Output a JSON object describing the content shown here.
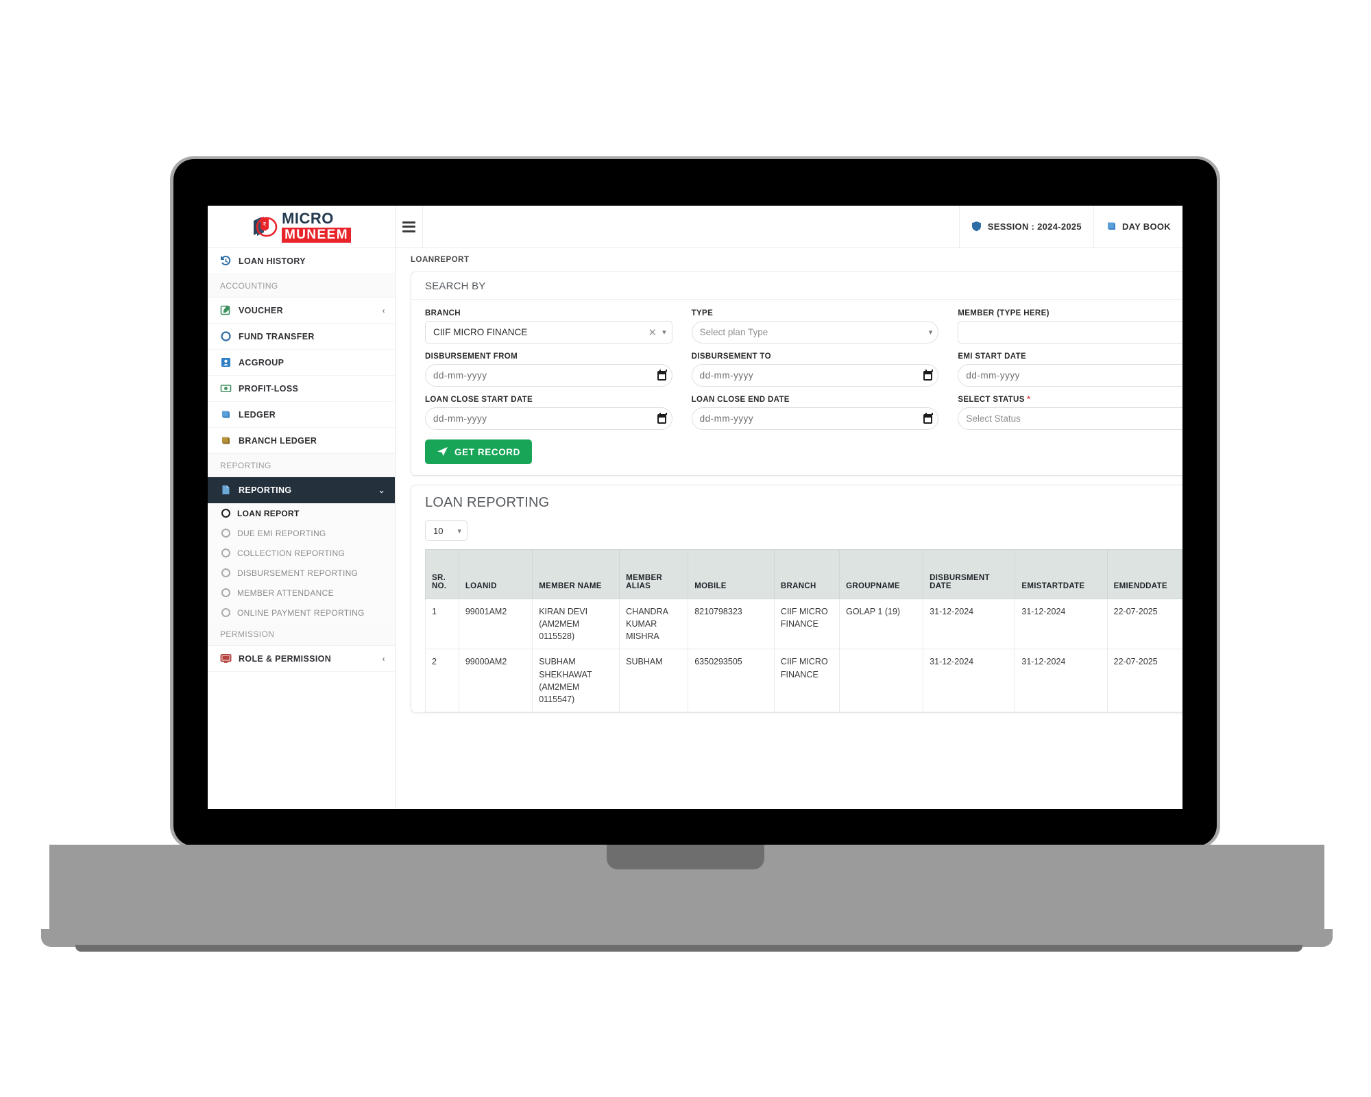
{
  "brand": {
    "micro": "MICRO",
    "muneem": "MUNEEM"
  },
  "topbar": {
    "menu_icon": "hamburger-icon",
    "session": {
      "icon": "shield-icon",
      "label": "SESSION : 2024-2025"
    },
    "daybook": {
      "icon": "book-icon",
      "label": "DAY BOOK"
    }
  },
  "breadcrumb": "LOANREPORT",
  "sidebar": {
    "items": [
      {
        "label": "LOAN HISTORY",
        "icon": "history-icon",
        "type": "item",
        "chevron": ""
      },
      {
        "label": "ACCOUNTING",
        "type": "section"
      },
      {
        "label": "VOUCHER",
        "icon": "voucher-edit-icon",
        "type": "item",
        "chevron": "‹"
      },
      {
        "label": "FUND TRANSFER",
        "icon": "circle-icon",
        "type": "item",
        "chevron": ""
      },
      {
        "label": "ACGROUP",
        "icon": "contact-card-icon",
        "type": "item",
        "chevron": ""
      },
      {
        "label": "PROFIT-LOSS",
        "icon": "money-icon",
        "type": "item",
        "chevron": ""
      },
      {
        "label": "LEDGER",
        "icon": "ledger-book-icon",
        "type": "item",
        "chevron": ""
      },
      {
        "label": "BRANCH LEDGER",
        "icon": "branch-ledger-book-icon",
        "type": "item",
        "chevron": ""
      },
      {
        "label": "REPORTING",
        "type": "section"
      },
      {
        "label": "REPORTING",
        "icon": "document-icon",
        "type": "active",
        "chevron": "⌄"
      }
    ],
    "sub_items": [
      {
        "label": "LOAN REPORT",
        "current": true
      },
      {
        "label": "DUE EMI REPORTING",
        "current": false
      },
      {
        "label": "COLLECTION REPORTING",
        "current": false
      },
      {
        "label": "DISBURSEMENT REPORTING",
        "current": false
      },
      {
        "label": "MEMBER ATTENDANCE",
        "current": false
      },
      {
        "label": "ONLINE PAYMENT REPORTING",
        "current": false
      }
    ],
    "permission_section": "PERMISSION",
    "permission_item": {
      "label": "ROLE & PERMISSION",
      "icon": "monitor-icon",
      "chevron": "‹"
    }
  },
  "search_card": {
    "title": "SEARCH BY",
    "fields": {
      "branch": {
        "label": "BRANCH",
        "value": "CIIF MICRO FINANCE"
      },
      "type": {
        "label": "TYPE",
        "value": "Select plan Type"
      },
      "member": {
        "label": "MEMBER (TYPE HERE)",
        "value": ""
      },
      "disbursement_from": {
        "label": "DISBURSEMENT FROM",
        "value": "dd-mm-yyyy"
      },
      "disbursement_to": {
        "label": "DISBURSEMENT TO",
        "value": "dd-mm-yyyy"
      },
      "emi_start_date": {
        "label": "EMI START DATE",
        "value": "dd-mm-yyyy"
      },
      "loan_close_start": {
        "label": "LOAN CLOSE START DATE",
        "value": "dd-mm-yyyy"
      },
      "loan_close_end": {
        "label": "LOAN CLOSE END DATE",
        "value": "dd-mm-yyyy"
      },
      "select_status": {
        "label": "SELECT STATUS",
        "required": "*",
        "value": "Select Status"
      }
    },
    "get_record_button": "GET RECORD"
  },
  "report_card": {
    "title": "LOAN REPORTING",
    "page_length": "10",
    "columns": [
      "SR. NO.",
      "LOANID",
      "MEMBER NAME",
      "MEMBER ALIAS",
      "MOBILE",
      "BRANCH",
      "GROUPNAME",
      "DISBURSMENT DATE",
      "EMISTARTDATE",
      "EMIENDDATE"
    ],
    "rows": [
      {
        "sr": "1",
        "loanid": "99001AM2",
        "member_name": "KIRAN DEVI (AM2MEM 0115528)",
        "member_alias": "CHANDRA KUMAR MISHRA",
        "mobile": "8210798323",
        "branch": "CIIF MICRO FINANCE",
        "groupname": "GOLAP 1 (19)",
        "disbursement_date": "31-12-2024",
        "emi_start_date": "31-12-2024",
        "emi_end_date": "22-07-2025"
      },
      {
        "sr": "2",
        "loanid": "99000AM2",
        "member_name": "SUBHAM SHEKHAWAT (AM2MEM 0115547)",
        "member_alias": "SUBHAM",
        "mobile": "6350293505",
        "branch": "CIIF MICRO FINANCE",
        "groupname": "",
        "disbursement_date": "31-12-2024",
        "emi_start_date": "31-12-2024",
        "emi_end_date": "22-07-2025"
      }
    ]
  },
  "colors": {
    "accent_green": "#18a558",
    "brand_red": "#e8242a",
    "brand_navy": "#22394f",
    "active_nav": "#24303c",
    "table_header": "#dde3e1"
  }
}
